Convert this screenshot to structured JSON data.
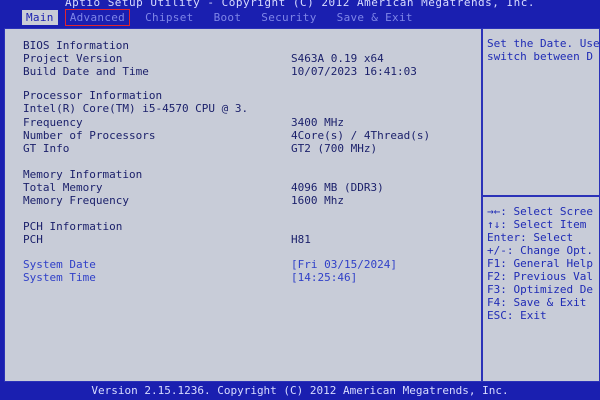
{
  "title": "Aptio Setup Utility - Copyright (C) 2012 American Megatrends, Inc.",
  "tabs": [
    "Main",
    "Advanced",
    "Chipset",
    "Boot",
    "Security",
    "Save & Exit"
  ],
  "rows": {
    "bios_info": "BIOS Information",
    "project_version_label": "Project Version",
    "project_version_value": "S463A 0.19 x64",
    "build_label": "Build Date and Time",
    "build_value": "10/07/2023 16:41:03",
    "processor_info": "Processor Information",
    "cpu_name": "Intel(R) Core(TM) i5-4570 CPU @ 3.",
    "frequency_label": "Frequency",
    "frequency_value": "3400 MHz",
    "num_proc_label": "Number of Processors",
    "num_proc_value": "4Core(s) / 4Thread(s)",
    "gt_label": "GT Info",
    "gt_value": "GT2 (700 MHz)",
    "memory_info": "Memory Information",
    "total_mem_label": "Total Memory",
    "total_mem_value": "4096 MB (DDR3)",
    "mem_freq_label": "Memory Frequency",
    "mem_freq_value": "1600 Mhz",
    "pch_info": "PCH Information",
    "pch_label": "PCH",
    "pch_value": "H81",
    "system_date_label": "System Date",
    "system_date_value": "[Fri 03/15/2024]",
    "system_time_label": "System Time",
    "system_time_value": "[14:25:46]"
  },
  "help": {
    "line1": "Set the Date. Use",
    "line2": "switch between D"
  },
  "keys": [
    "→←: Select Scree",
    "↑↓: Select Item",
    "Enter: Select",
    "+/-: Change Opt.",
    "F1: General Help",
    "F2: Previous Val",
    "F3: Optimized De",
    "F4: Save & Exit",
    "ESC: Exit"
  ],
  "footer": "Version 2.15.1236. Copyright (C) 2012 American Megatrends, Inc."
}
